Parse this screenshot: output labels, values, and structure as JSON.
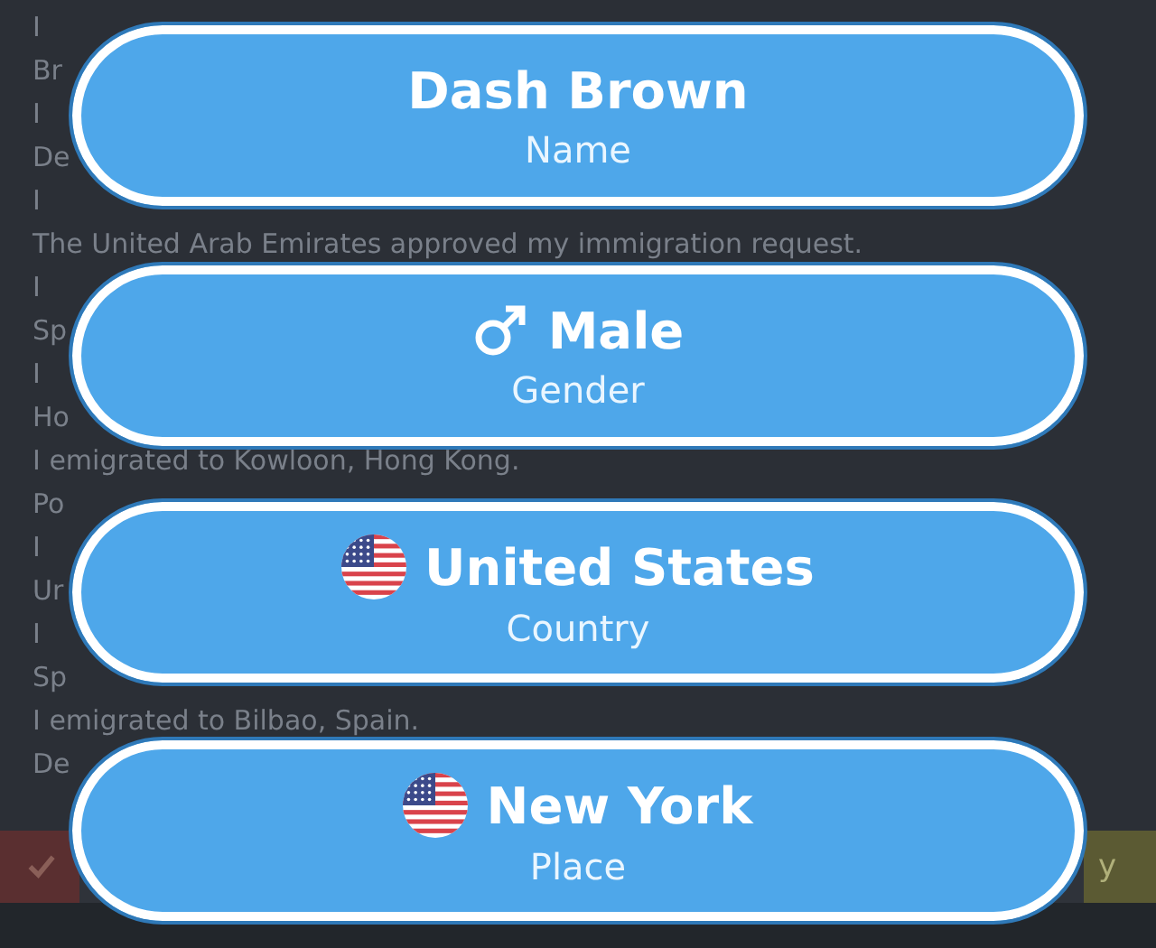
{
  "log": [
    "I",
    "Br",
    "I",
    "De",
    "I",
    "The United Arab Emirates approved my immigration request.",
    "I",
    "Sp",
    "I",
    "Ho",
    "I emigrated to Kowloon, Hong Kong.",
    "Po",
    "I",
    "Ur",
    "I",
    "Sp",
    "I emigrated to Bilbao, Spain.",
    "De"
  ],
  "bottom_bar": {
    "right_text": "y"
  },
  "choices": [
    {
      "value": "Dash Brown",
      "label": "Name",
      "kind": "text"
    },
    {
      "value": "Male",
      "label": "Gender",
      "kind": "gender"
    },
    {
      "value": "United States",
      "label": "Country",
      "kind": "flag"
    },
    {
      "value": "New York",
      "label": "Place",
      "kind": "flag"
    }
  ]
}
